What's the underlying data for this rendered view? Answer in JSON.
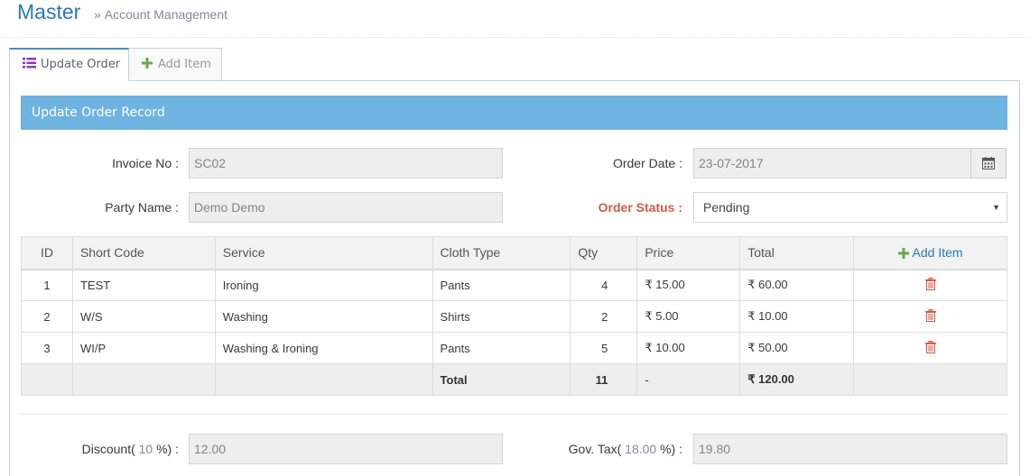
{
  "header": {
    "title": "Master",
    "breadcrumb_sep": "»",
    "breadcrumb": "Account Management"
  },
  "tabs": [
    {
      "label": "Update Order"
    },
    {
      "label": "Add Item"
    }
  ],
  "form": {
    "section_title": "Update Order Record",
    "invoice_label": "Invoice No :",
    "invoice_value": "SC02",
    "order_date_label": "Order Date :",
    "order_date_value": "23-07-2017",
    "party_label": "Party Name :",
    "party_value": "Demo Demo",
    "status_label": "Order Status :",
    "status_value": "Pending"
  },
  "table": {
    "headers": {
      "id": "ID",
      "short_code": "Short Code",
      "service": "Service",
      "cloth_type": "Cloth Type",
      "qty": "Qty",
      "price": "Price",
      "total": "Total",
      "add_item": "Add Item"
    },
    "rows": [
      {
        "id": "1",
        "short_code": "TEST",
        "service": "Ironing",
        "cloth_type": "Pants",
        "qty": "4",
        "price": "₹ 15.00",
        "total": "₹ 60.00"
      },
      {
        "id": "2",
        "short_code": "W/S",
        "service": "Washing",
        "cloth_type": "Shirts",
        "qty": "2",
        "price": "₹ 5.00",
        "total": "₹ 10.00"
      },
      {
        "id": "3",
        "short_code": "WI/P",
        "service": "Washing & Ironing",
        "cloth_type": "Pants",
        "qty": "5",
        "price": "₹ 10.00",
        "total": "₹ 50.00"
      }
    ],
    "totals": {
      "label": "Total",
      "qty": "11",
      "price": "-",
      "total": "₹ 120.00"
    }
  },
  "summary": {
    "discount_prefix": "Discount(",
    "discount_pct": "10",
    "discount_suffix": "%) :",
    "discount_value": "12.00",
    "tax_prefix": "Gov. Tax(",
    "tax_pct": "18.00",
    "tax_suffix": "%) :",
    "tax_value": "19.80"
  },
  "colors": {
    "accent": "#6fb3e0",
    "title": "#2679b5",
    "status_label": "#d15b47",
    "trash": "#d15b47",
    "add_green": "#69aa46",
    "list_icon": "#8a3ab9"
  },
  "icons": {
    "tab1": "list-icon",
    "tab2": "plus-icon",
    "date": "calendar-icon",
    "row_action": "trash-icon",
    "add": "plus-icon"
  }
}
